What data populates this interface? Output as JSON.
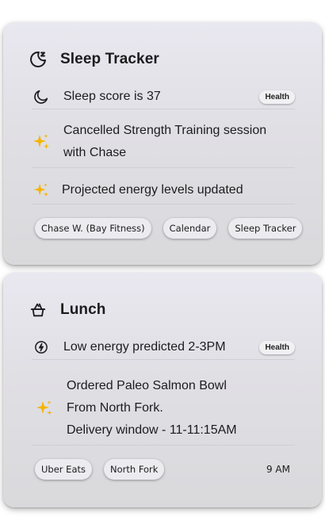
{
  "sleep_card": {
    "title": "Sleep Tracker",
    "header_icon": "moon-refresh-icon",
    "rows": [
      {
        "icon": "moon-icon",
        "text": "Sleep score is 37",
        "badge": "Health"
      },
      {
        "icon": "sparkles-icon",
        "text_line1": "Cancelled Strength Training session",
        "text_line2": "with Chase"
      },
      {
        "icon": "sparkles-icon",
        "text": "Projected energy levels updated"
      }
    ],
    "chips": [
      "Chase W. (Bay Fitness)",
      "Calendar",
      "Sleep Tracker"
    ]
  },
  "lunch_card": {
    "title": "Lunch",
    "header_icon": "food-bowl-icon",
    "rows": [
      {
        "icon": "energy-bolt-icon",
        "text": "Low energy predicted 2-3PM",
        "badge": "Health"
      },
      {
        "icon": "sparkles-icon",
        "text_line1": "Ordered Paleo Salmon Bowl",
        "text_line2": "From North Fork.",
        "text_line3": "Delivery window - 11-11:15AM"
      }
    ],
    "chips": [
      "Uber Eats",
      "North Fork"
    ],
    "time": "9 AM"
  },
  "colors": {
    "sparkle": "#f5b400",
    "icon_dark": "#1c1c1e"
  }
}
